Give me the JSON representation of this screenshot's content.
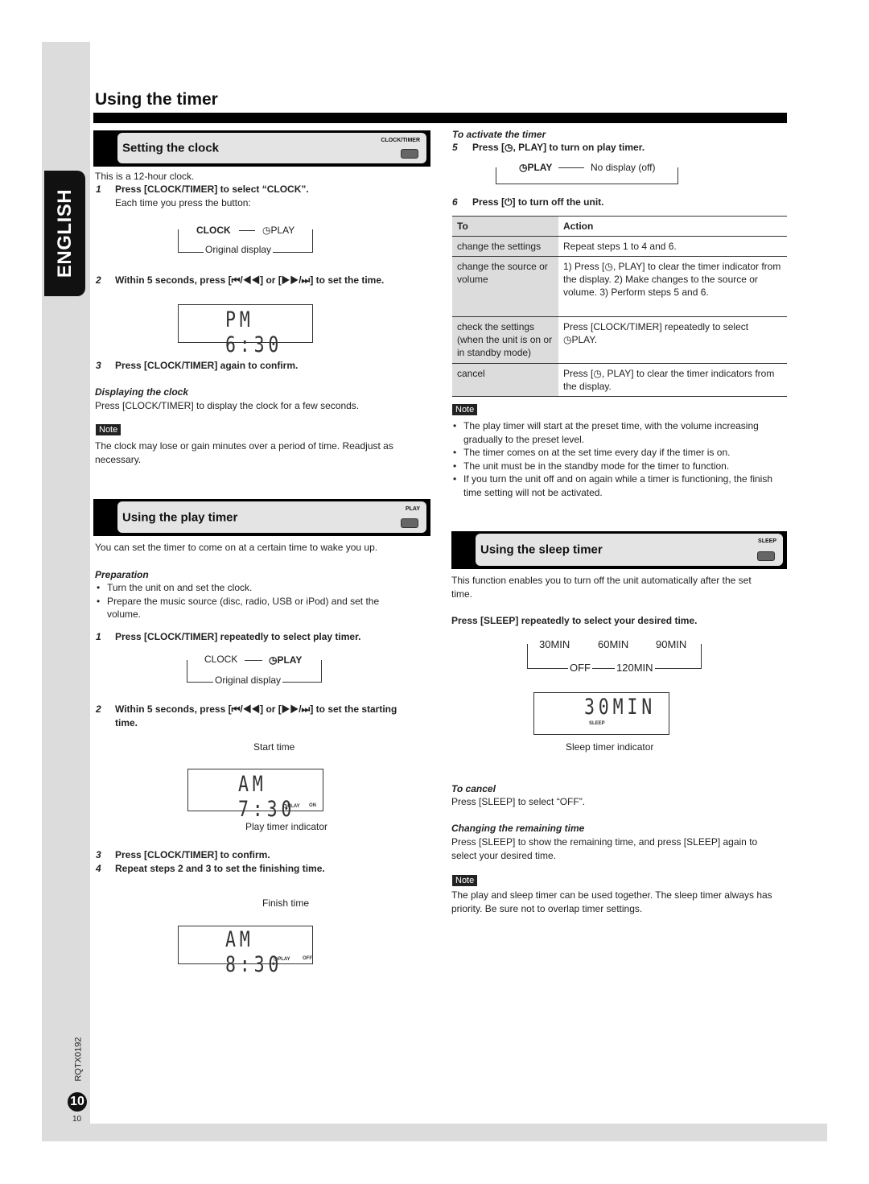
{
  "side": {
    "language_tab": "ENGLISH",
    "doc_code": "RQTX0192",
    "page_number": "10"
  },
  "title": "Using the timer",
  "clock": {
    "header": "Setting the clock",
    "button_label": "CLOCK/TIMER",
    "intro": "This is a 12-hour clock.",
    "step1_num": "1",
    "step1": "Press [CLOCK/TIMER] to select “CLOCK”.",
    "step1_sub": "Each time you press the button:",
    "cycle": [
      "CLOCK",
      "◷PLAY",
      "Original display"
    ],
    "step2_num": "2",
    "step2": "Within 5 seconds, press [⏮/◀◀] or [▶▶/⏭] to set the time.",
    "display": "PM 6:30",
    "step3_num": "3",
    "step3": "Press [CLOCK/TIMER] again to confirm.",
    "displaying_heading": "Displaying the clock",
    "displaying_text": "Press [CLOCK/TIMER] to display the clock for a few seconds.",
    "note_label": "Note",
    "note_lines": [
      "The clock may lose or gain minutes over a period of time. Readjust as",
      "necessary."
    ]
  },
  "play": {
    "header": "Using the play timer",
    "button_label": "PLAY",
    "intro": "You can set the timer to come on at a certain time to wake you up.",
    "prep_heading": "Preparation",
    "prep": [
      "Turn the unit on and set the clock.",
      "Prepare the music source (disc, radio, USB or iPod) and set the",
      "volume."
    ],
    "step1_num": "1",
    "step1": "Press [CLOCK/TIMER] repeatedly to select play timer.",
    "cycle": [
      "CLOCK",
      "◷PLAY",
      "Original display"
    ],
    "step2_num": "2",
    "step2": "Within 5 seconds, press [⏮/◀◀] or [▶▶/⏭] to set the starting",
    "step2b": "time.",
    "start_label": "Start time",
    "start_display": "AM 7:30",
    "ind_play": "◷PLAY",
    "ind_on": "ON",
    "indicator_label": "Play timer indicator",
    "step3_num": "3",
    "step3": "Press [CLOCK/TIMER] to confirm.",
    "step4_num": "4",
    "step4": "Repeat steps 2 and 3 to set the finishing time.",
    "finish_label": "Finish time",
    "finish_display": "AM 8:30",
    "ind_off": "OFF"
  },
  "activate": {
    "heading": "To activate the timer",
    "step5_num": "5",
    "step5": "Press [◷, PLAY] to turn on play timer.",
    "cycle": [
      "◷PLAY",
      "No display (off)"
    ],
    "step6_num": "6",
    "step6": "Press [⏻] to turn off the unit.",
    "table": {
      "headers": [
        "To",
        "Action"
      ],
      "rows": [
        {
          "to": "change the settings",
          "action": "Repeat steps 1 to 4 and 6."
        },
        {
          "to": "change the source or volume",
          "action": "1) Press [◷, PLAY] to clear the timer indicator from the display. 2) Make changes to the source or volume. 3) Perform steps 5 and 6."
        },
        {
          "to": "check the settings (when the unit is on or in standby mode)",
          "action": "Press [CLOCK/TIMER] repeatedly to select ◷PLAY."
        },
        {
          "to": "cancel",
          "action": "Press [◷, PLAY] to clear the timer indicators from the display."
        }
      ]
    },
    "note_label": "Note",
    "notes": [
      "The play timer will start at the preset time, with the volume increasing gradually to the preset level.",
      "The timer comes on at the set time every day if the timer is on.",
      "The unit must be in the standby mode for the timer to function.",
      "If you turn the unit off and on again while a timer is functioning, the finish time setting will not be activated."
    ]
  },
  "sleep": {
    "header": "Using the sleep timer",
    "button_label": "SLEEP",
    "intro": "This function enables you to turn off the unit automatically after the set time.",
    "instruction": "Press [SLEEP] repeatedly to select your desired time.",
    "cycle": [
      "30MIN",
      "60MIN",
      "90MIN",
      "120MIN",
      "OFF"
    ],
    "display": "30MIN",
    "ind_sleep": "SLEEP",
    "indicator_label": "Sleep timer indicator",
    "cancel_heading": "To cancel",
    "cancel_text": "Press [SLEEP] to select “OFF”.",
    "change_heading": "Changing the remaining time",
    "change_text": "Press [SLEEP] to show the remaining time, and press [SLEEP] again to select your desired time.",
    "note_label": "Note",
    "note_text": "The play and sleep timer can be used together. The sleep timer always has priority. Be sure not to overlap timer settings."
  }
}
